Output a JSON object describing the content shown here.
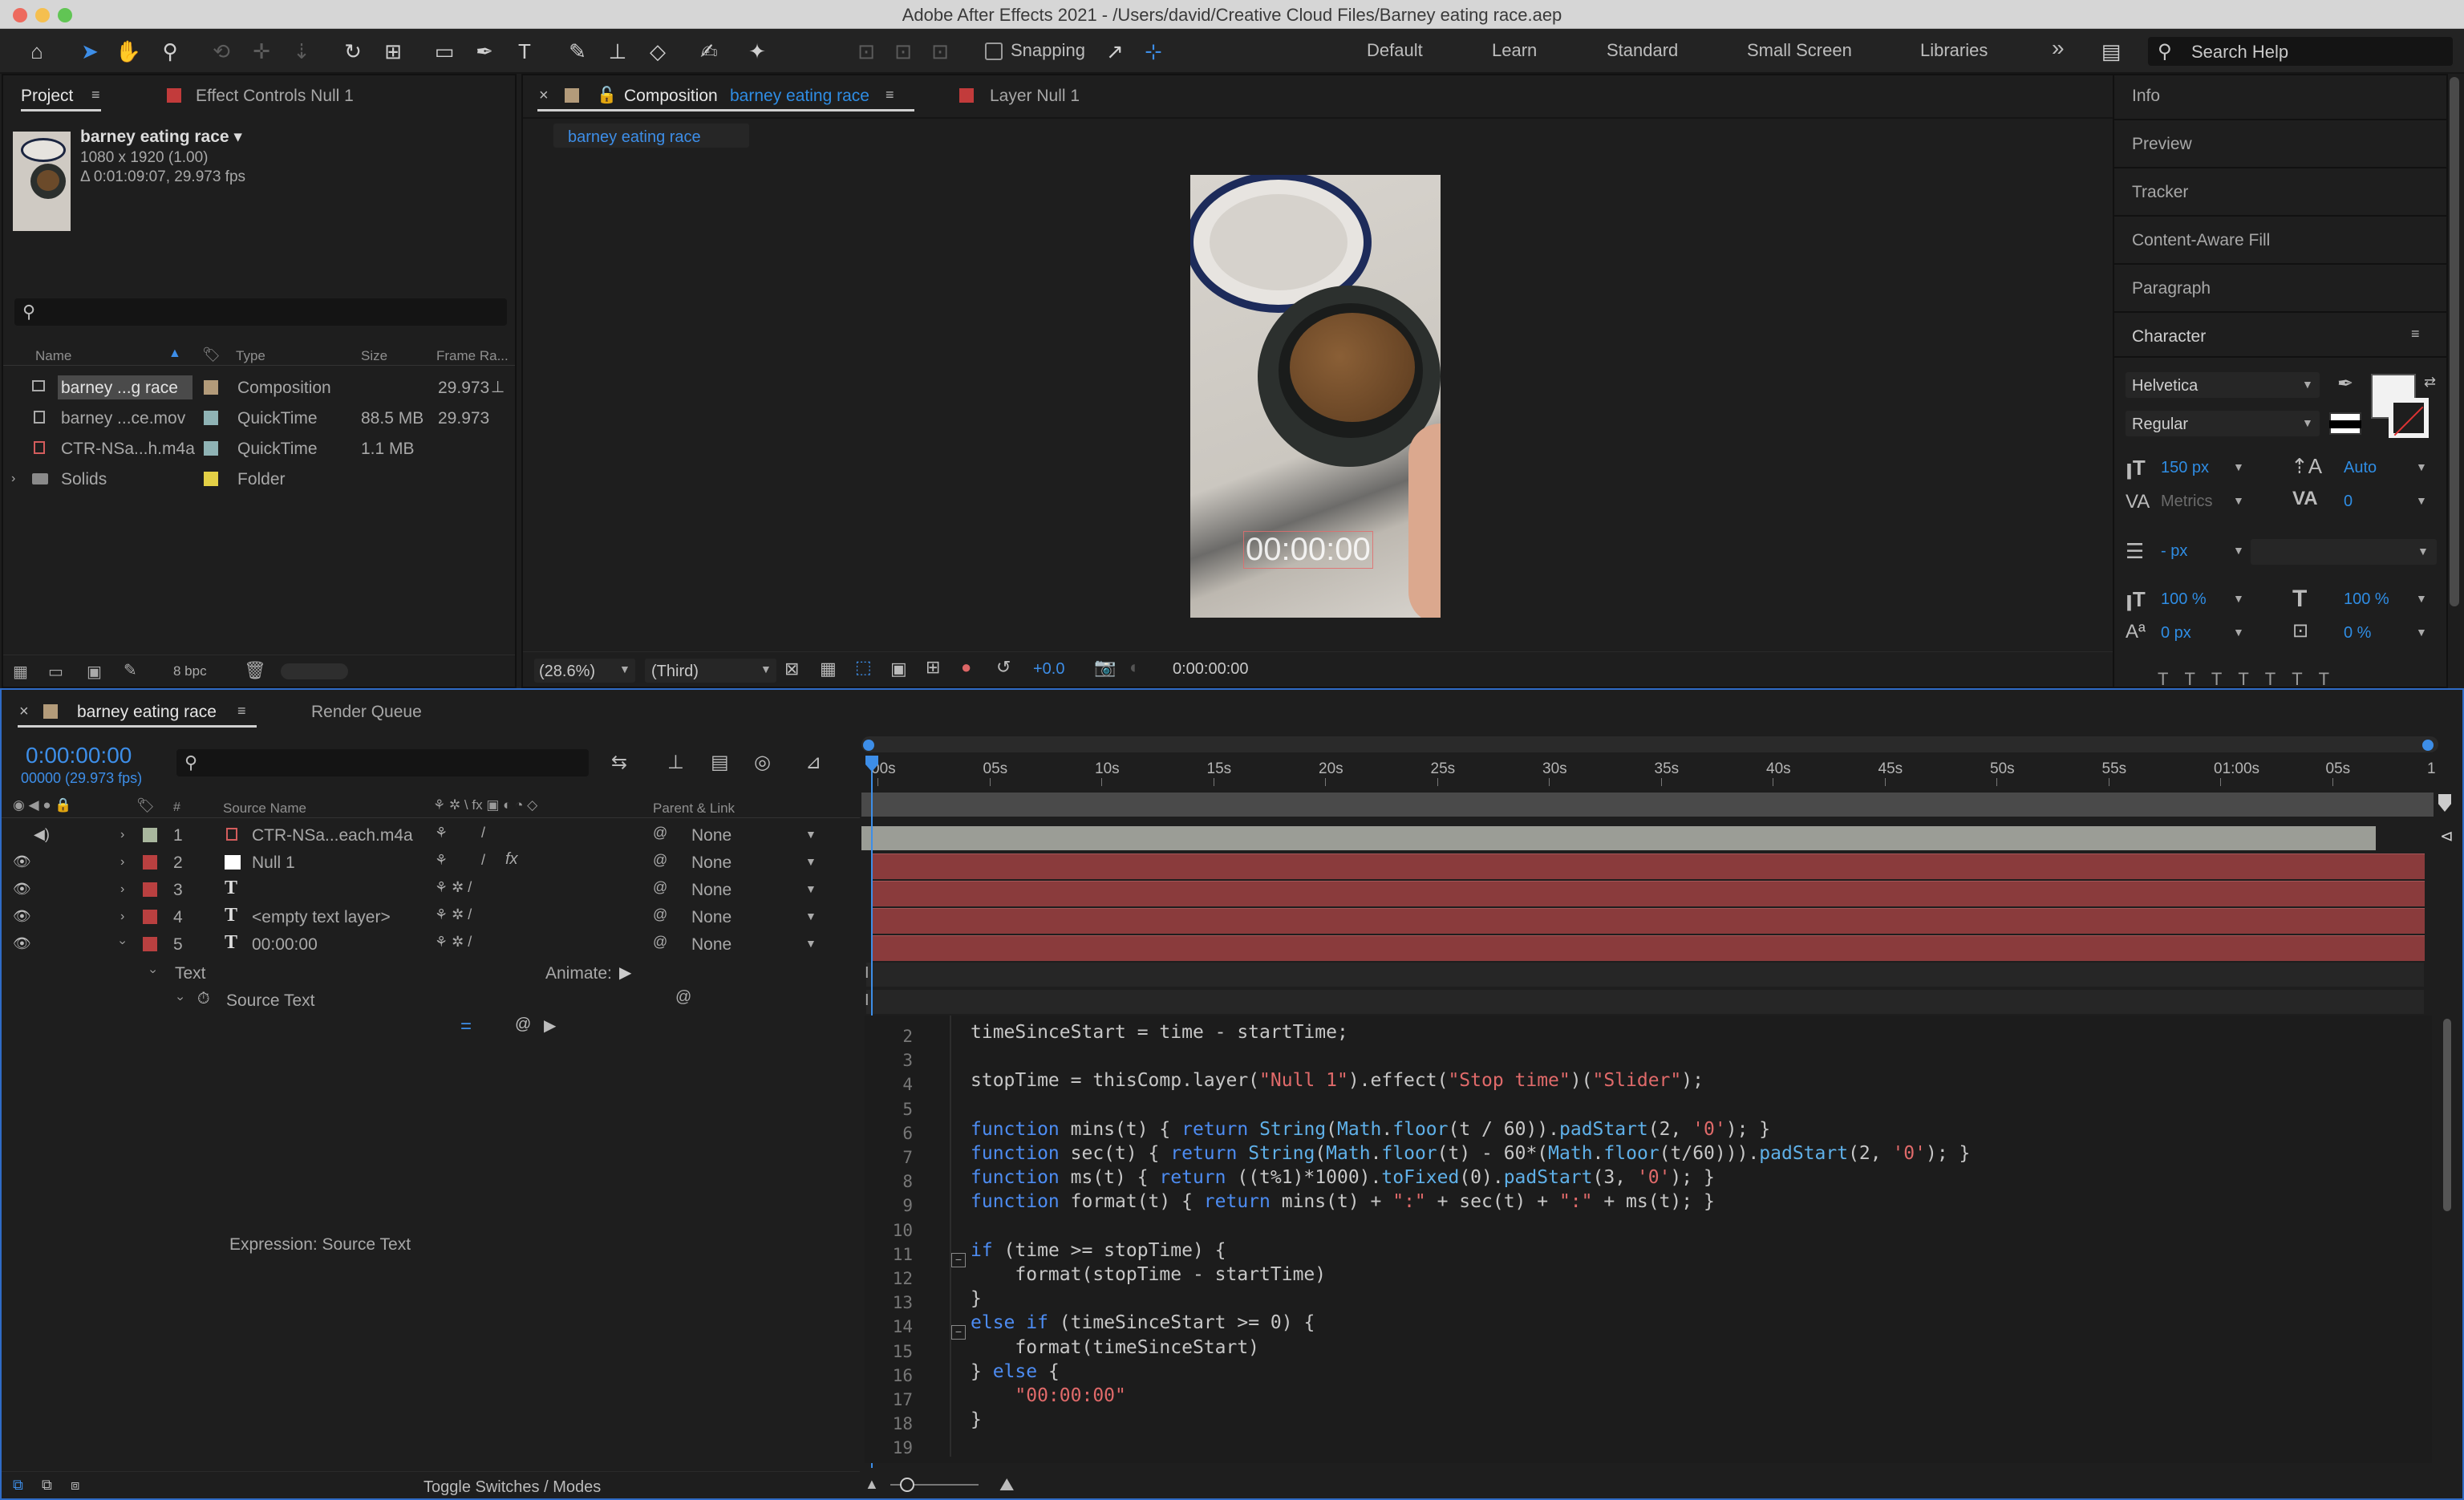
{
  "app": {
    "title": "Adobe After Effects 2021 - /Users/david/Creative Cloud Files/Barney eating race.aep"
  },
  "toolbar": {
    "snapping_label": "Snapping",
    "workspaces": [
      "Default",
      "Learn",
      "Standard",
      "Small Screen",
      "Libraries"
    ],
    "more": "»",
    "search_placeholder": "Search Help"
  },
  "project_panel": {
    "tab_project": "Project",
    "tab_effect_controls": "Effect Controls Null 1",
    "comp_name": "barney eating race ▾",
    "comp_size": "1080 x 1920 (1.00)",
    "comp_duration": "Δ 0:01:09:07, 29.973 fps",
    "columns": {
      "name": "Name",
      "type": "Type",
      "size": "Size",
      "frame_rate": "Frame Ra..."
    },
    "items": [
      {
        "name": "barney ...g race",
        "type": "Composition",
        "size": "",
        "fps": "29.973",
        "swatch": "#b39b7a"
      },
      {
        "name": "barney ...ce.mov",
        "type": "QuickTime",
        "size": "88.5 MB",
        "fps": "29.973",
        "swatch": "#8fb3b5"
      },
      {
        "name": "CTR-NSa...h.m4a",
        "type": "QuickTime",
        "size": "1.1 MB",
        "fps": "",
        "swatch": "#8fb3b5"
      },
      {
        "name": "Solids",
        "type": "Folder",
        "size": "",
        "fps": "",
        "swatch": "#e3d046"
      }
    ],
    "bpc": "8 bpc"
  },
  "composition_panel": {
    "tab_label": "Composition",
    "tab_name": "barney eating race",
    "tab_layer": "Layer Null 1",
    "breadcrumb": "barney eating race",
    "overlay_timecode": "00:00:00",
    "zoom": "(28.6%)",
    "resolution": "(Third)",
    "exposure": "+0.0",
    "timecode": "0:00:00:00"
  },
  "right_panels": {
    "items": [
      "Info",
      "Preview",
      "Tracker",
      "Content-Aware Fill",
      "Paragraph"
    ],
    "character_title": "Character",
    "font": "Helvetica",
    "style": "Regular",
    "font_size": "150 px",
    "leading": "Auto",
    "kerning": "Metrics",
    "tracking": "0",
    "stroke": "- px",
    "vscale": "100 %",
    "hscale": "100 %",
    "baseline": "0 px",
    "tsume": "0 %"
  },
  "timeline": {
    "tab_comp": "barney eating race",
    "tab_render": "Render Queue",
    "timecode": "0:00:00:00",
    "frames": "00000 (29.973 fps)",
    "col_hash": "#",
    "col_source": "Source Name",
    "col_parent": "Parent & Link",
    "ruler": [
      "00s",
      "05s",
      "10s",
      "15s",
      "20s",
      "25s",
      "30s",
      "35s",
      "40s",
      "45s",
      "50s",
      "55s",
      "01:00s",
      "05s",
      "1"
    ],
    "layers": [
      {
        "num": "1",
        "name": "CTR-NSa...each.m4a",
        "parent": "None",
        "swatch": "#a9b79e"
      },
      {
        "num": "2",
        "name": "Null 1",
        "parent": "None",
        "swatch": "#b94040"
      },
      {
        "num": "3",
        "name": "",
        "parent": "None",
        "swatch": "#b94040"
      },
      {
        "num": "4",
        "name": "<empty text layer>",
        "parent": "None",
        "swatch": "#b94040"
      },
      {
        "num": "5",
        "name": "00:00:00",
        "parent": "None",
        "swatch": "#b94040"
      }
    ],
    "text_group": "Text",
    "animate": "Animate:",
    "source_text": "Source Text",
    "expression_label": "Expression: Source Text",
    "toggle": "Toggle Switches / Modes"
  },
  "expression": {
    "line_numbers": [
      "2",
      "3",
      "4",
      "5",
      "6",
      "7",
      "8",
      "9",
      "10",
      "11",
      "12",
      "13",
      "14",
      "15",
      "16",
      "17",
      "18",
      "19"
    ],
    "lines": [
      "timeSinceStart = time - startTime;",
      "",
      "stopTime = thisComp.layer(\"Null 1\").effect(\"Stop time\")(\"Slider\");",
      "",
      "function mins(t) { return String(Math.floor(t / 60)).padStart(2, '0'); }",
      "function sec(t) { return String(Math.floor(t) - 60*(Math.floor(t/60))).padStart(2, '0'); }",
      "function ms(t) { return ((t%1)*1000).toFixed(0).padStart(3, '0'); }",
      "function format(t) { return mins(t) + \":\" + sec(t) + \":\" + ms(t); }",
      "",
      "if (time >= stopTime) {",
      "    format(stopTime - startTime)",
      "}",
      "else if (timeSinceStart >= 0) {",
      "    format(timeSinceStart)",
      "} else {",
      "    \"00:00:00\"",
      "}",
      ""
    ]
  }
}
